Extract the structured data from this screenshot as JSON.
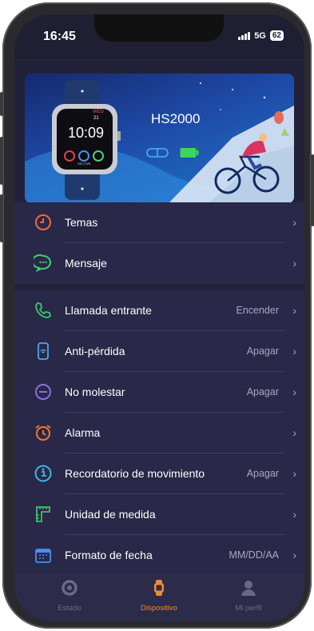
{
  "status_bar": {
    "time": "16:45",
    "network": "5G",
    "battery": "62"
  },
  "banner": {
    "device_name": "HS2000",
    "watch_time": "10:09",
    "watch_brand": "SECTUR",
    "watch_top_label": "WED",
    "watch_date": "21"
  },
  "section1": [
    {
      "label": "Temas",
      "icon": "theme-clock-icon",
      "color": "#f06a3a"
    },
    {
      "label": "Mensaje",
      "icon": "message-icon",
      "color": "#3cd07a"
    }
  ],
  "section2": [
    {
      "label": "Llamada entrante",
      "value": "Encender",
      "icon": "phone-icon",
      "color": "#38c96c"
    },
    {
      "label": "Anti-pérdida",
      "value": "Apagar",
      "icon": "watch-signal-icon",
      "color": "#4aa8f0"
    },
    {
      "label": "No molestar",
      "value": "Apagar",
      "icon": "do-not-disturb-icon",
      "color": "#8b6ee0"
    },
    {
      "label": "Alarma",
      "value": "",
      "icon": "alarm-icon",
      "color": "#f07a2a"
    },
    {
      "label": "Recordatorio de movimiento",
      "value": "Apagar",
      "icon": "movement-icon",
      "color": "#3fb8e8"
    },
    {
      "label": "Unidad de medida",
      "value": "",
      "icon": "ruler-icon",
      "color": "#3cc46a"
    },
    {
      "label": "Formato de fecha",
      "value": "MM/DD/AA",
      "icon": "calendar-icon",
      "color": "#4a8ef0"
    }
  ],
  "tabbar": {
    "tabs": [
      {
        "label": "Estado",
        "active": false
      },
      {
        "label": "Dispositivo",
        "active": true
      },
      {
        "label": "Mi perfil",
        "active": false
      }
    ],
    "active_color": "#f28a2e",
    "inactive_color": "#6b6a86"
  }
}
